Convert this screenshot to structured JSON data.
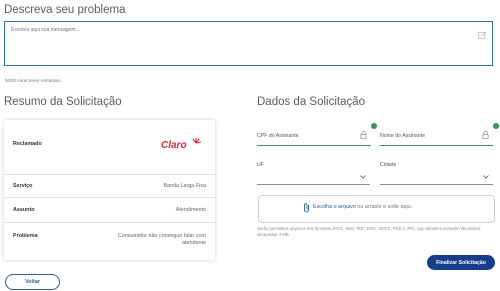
{
  "problem": {
    "heading": "Descreva seu problema",
    "placeholder": "Escreva aqui sua mensagem...",
    "chars_remaining": "5000 caracteres restantes."
  },
  "summary": {
    "heading": "Resumo da Solicitação",
    "rows": [
      {
        "label": "Reclamado",
        "value": ""
      },
      {
        "label": "Serviço",
        "value": "Banda Larga Fixa"
      },
      {
        "label": "Assunto",
        "value": "Atendimento"
      },
      {
        "label": "Problema",
        "value": "Consumidor não consegue falar com atendente"
      }
    ],
    "brand_logo": "Claro"
  },
  "details": {
    "heading": "Dados da Solicitação",
    "cpf_label": "CPF do Assinante",
    "name_label": "Nome do Assinante",
    "uf_label": "UF",
    "city_label": "Cidade",
    "upload_link": "Escolha o arquivo",
    "upload_rest": " ou arraste e solte aqui.",
    "upload_hint": "Serão permitidos arquivos nos formatos JPEG, WAV, PDF, DOC, DOCX, PNG e JPG, cujo tamanho somado não poderá ultrapassar 3 MB."
  },
  "buttons": {
    "back": "Voltar",
    "submit": "Finalizar Solicitação"
  },
  "colors": {
    "accent": "#173e8c",
    "valid": "#2e9a4a",
    "brand": "#e3262b"
  }
}
